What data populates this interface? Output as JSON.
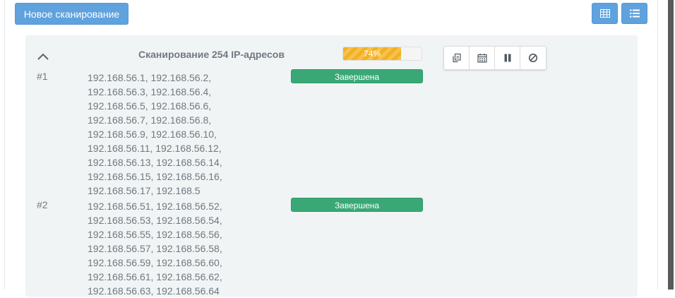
{
  "toolbar": {
    "new_scan_label": "Новое сканирование"
  },
  "view_toggle": {
    "table_icon": "table-icon",
    "list_icon": "list-icon"
  },
  "scan": {
    "title": "Сканирование 254 IP-адресов",
    "progress_percent": 74,
    "progress_label": "74%",
    "actions": [
      "copy-icon",
      "calendar-icon",
      "pause-icon",
      "cancel-icon"
    ],
    "collapse_icon": "chevron-up-icon",
    "rows": [
      {
        "index": "#1",
        "ips": "192.168.56.1, 192.168.56.2, 192.168.56.3, 192.168.56.4, 192.168.56.5, 192.168.56.6, 192.168.56.7, 192.168.56.8, 192.168.56.9, 192.168.56.10, 192.168.56.11, 192.168.56.12, 192.168.56.13, 192.168.56.14, 192.168.56.15, 192.168.56.16, 192.168.56.17, 192.168.5",
        "status": "Завершена"
      },
      {
        "index": "#2",
        "ips": "192.168.56.51, 192.168.56.52, 192.168.56.53, 192.168.56.54, 192.168.56.55, 192.168.56.56, 192.168.56.57, 192.168.56.58, 192.168.56.59, 192.168.56.60, 192.168.56.61, 192.168.56.62, 192.168.56.63, 192.168.56.64",
        "status": "Завершена"
      }
    ]
  },
  "colors": {
    "primary": "#5fa2dd",
    "success": "#3aa876",
    "warning": "#f4b01f",
    "card_bg": "#f1f4f5",
    "text": "#6f7980"
  }
}
